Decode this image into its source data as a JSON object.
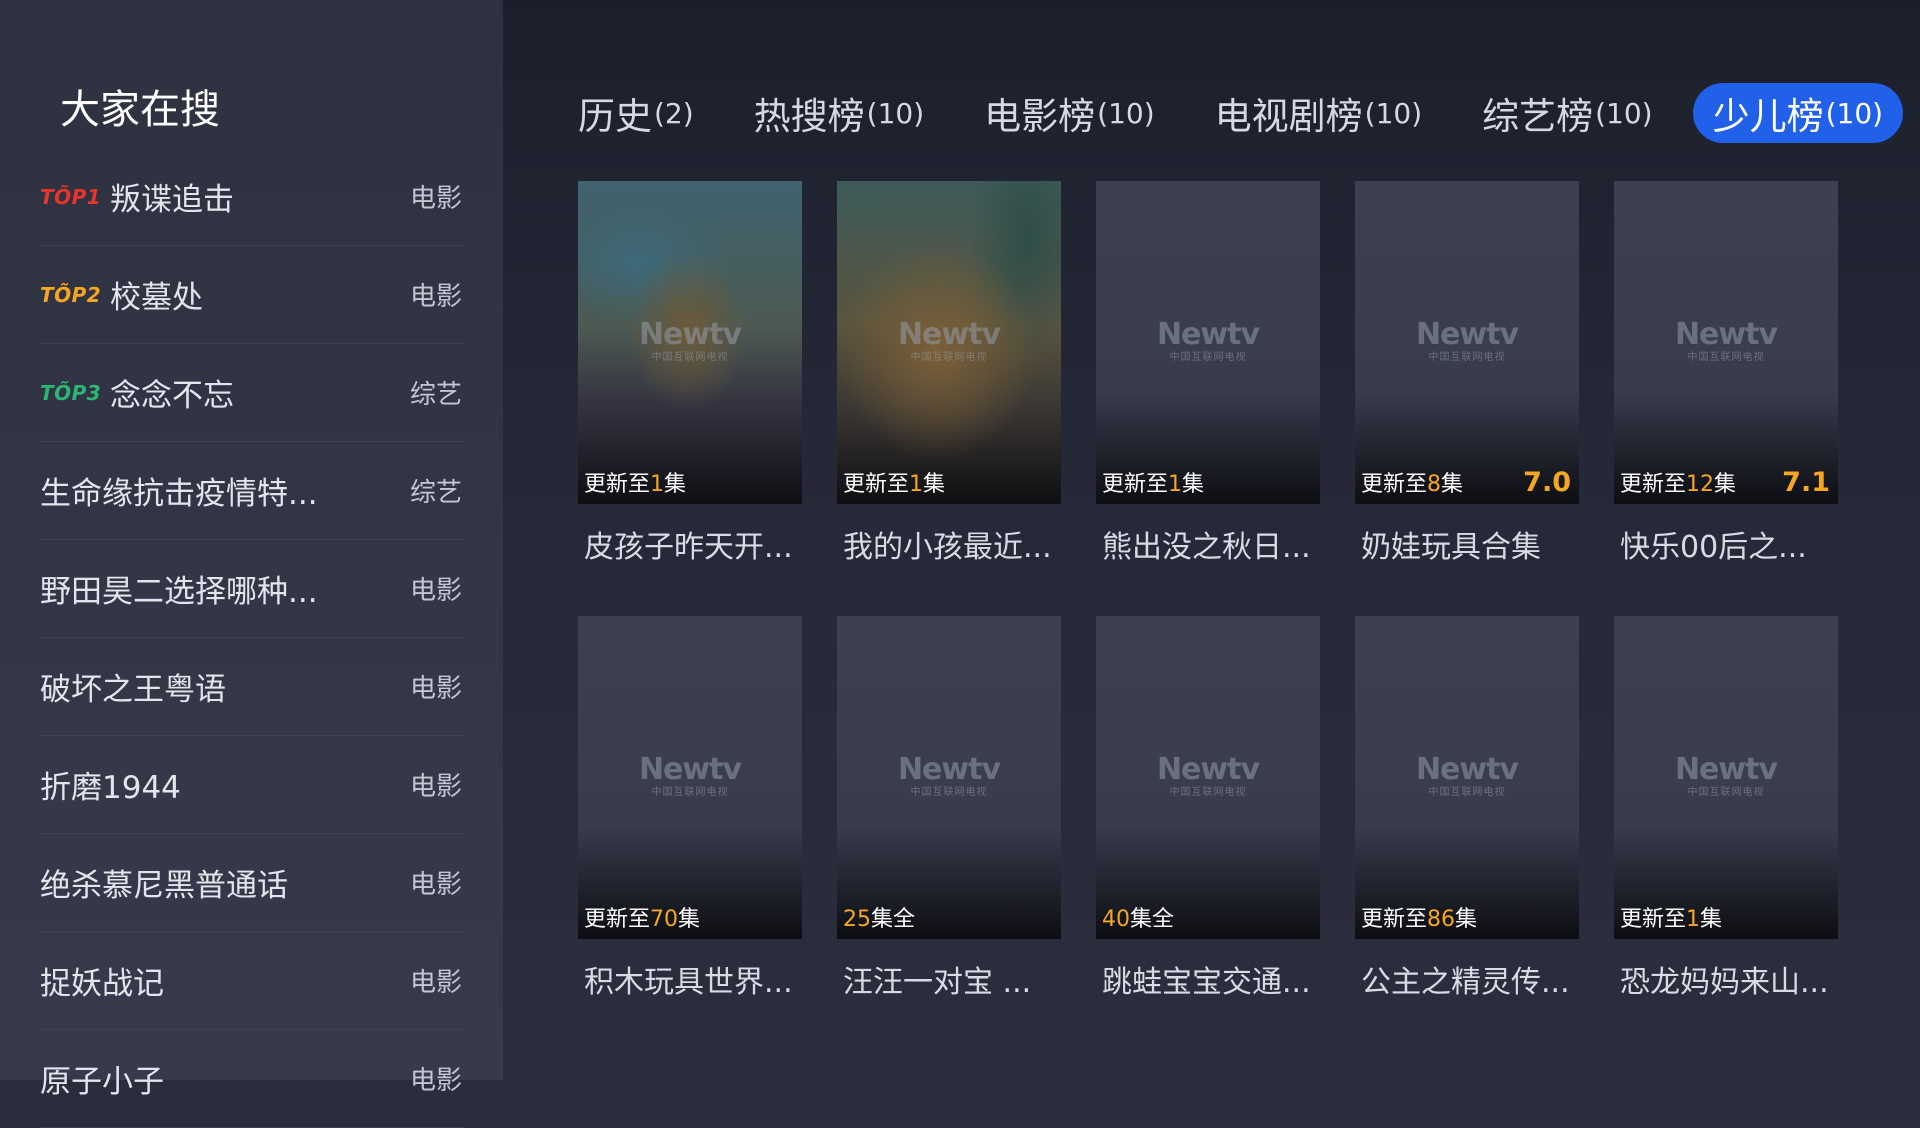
{
  "sidebar": {
    "title": "大家在搜",
    "items": [
      {
        "rank": "TÕP1",
        "rank_color": "#e8352c",
        "name": "叛谍追击",
        "type": "电影"
      },
      {
        "rank": "TÕP2",
        "rank_color": "#f5a623",
        "name": "校墓处",
        "type": "电影"
      },
      {
        "rank": "TÕP3",
        "rank_color": "#2bb673",
        "name": "念念不忘",
        "type": "综艺"
      },
      {
        "rank": "",
        "name": "生命缘抗击疫情特...",
        "type": "综艺"
      },
      {
        "rank": "",
        "name": "野田昊二选择哪种...",
        "type": "电影"
      },
      {
        "rank": "",
        "name": "破坏之王粤语",
        "type": "电影"
      },
      {
        "rank": "",
        "name": "折磨1944",
        "type": "电影"
      },
      {
        "rank": "",
        "name": "绝杀慕尼黑普通话",
        "type": "电影"
      },
      {
        "rank": "",
        "name": "捉妖战记",
        "type": "电影"
      },
      {
        "rank": "",
        "name": "原子小子",
        "type": "电影"
      }
    ]
  },
  "tabs": [
    {
      "label": "历史",
      "count": "(2)",
      "active": false
    },
    {
      "label": "热搜榜",
      "count": "(10)",
      "active": false
    },
    {
      "label": "电影榜",
      "count": "(10)",
      "active": false
    },
    {
      "label": "电视剧榜",
      "count": "(10)",
      "active": false
    },
    {
      "label": "综艺榜",
      "count": "(10)",
      "active": false
    },
    {
      "label": "少儿榜",
      "count": "(10)",
      "active": true
    }
  ],
  "logo": {
    "main": "Newtv",
    "sub": "中国互联网电视"
  },
  "cards": [
    {
      "title": "皮孩子昨天开...",
      "update_pre": "更新至",
      "update_num": "1",
      "update_post": "集",
      "score": "",
      "art": "art1"
    },
    {
      "title": "我的小孩最近...",
      "update_pre": "更新至",
      "update_num": "1",
      "update_post": "集",
      "score": "",
      "art": "art2"
    },
    {
      "title": "熊出没之秋日...",
      "update_pre": "更新至",
      "update_num": "1",
      "update_post": "集",
      "score": "",
      "art": ""
    },
    {
      "title": "奶娃玩具合集",
      "update_pre": "更新至",
      "update_num": "8",
      "update_post": "集",
      "score": "7.0",
      "art": ""
    },
    {
      "title": "快乐00后之...",
      "update_pre": "更新至",
      "update_num": "12",
      "update_post": "集",
      "score": "7.1",
      "art": ""
    },
    {
      "title": "积木玩具世界...",
      "update_pre": "更新至",
      "update_num": "70",
      "update_post": "集",
      "score": "",
      "art": ""
    },
    {
      "title": "汪汪一对宝 ...",
      "update_pre": "",
      "update_num": "25",
      "update_post": "集全",
      "score": "",
      "art": ""
    },
    {
      "title": "跳蛙宝宝交通...",
      "update_pre": "",
      "update_num": "40",
      "update_post": "集全",
      "score": "",
      "art": ""
    },
    {
      "title": "公主之精灵传...",
      "update_pre": "更新至",
      "update_num": "86",
      "update_post": "集",
      "score": "",
      "art": ""
    },
    {
      "title": "恐龙妈妈来山...",
      "update_pre": "更新至",
      "update_num": "1",
      "update_post": "集",
      "score": "",
      "art": ""
    }
  ]
}
